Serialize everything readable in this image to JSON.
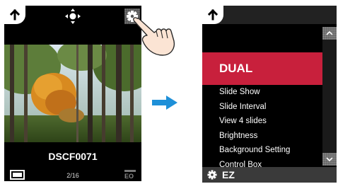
{
  "left_screen": {
    "filename": "DSCF0071",
    "counter": "2/16",
    "icons": {
      "back": "back-arrow-icon",
      "dpad": "dpad-icon",
      "settings": "gear-icon",
      "view": "single-view-icon",
      "eo": "eo-mode-icon"
    }
  },
  "right_screen": {
    "menu_items": [
      "DUAL",
      "Slide Show",
      "Slide Interval",
      "View 4 slides",
      "Brightness",
      "Background Setting",
      "Control Box"
    ],
    "selected_index": 0,
    "bottom_label": "EZ",
    "icons": {
      "back": "back-arrow-icon",
      "scroll_up": "chevron-up-icon",
      "scroll_down": "chevron-down-icon",
      "settings": "gear-icon"
    }
  },
  "colors": {
    "accent_selected": "#c8203c",
    "arrow": "#1e90d8",
    "screen_bg": "#000000"
  }
}
